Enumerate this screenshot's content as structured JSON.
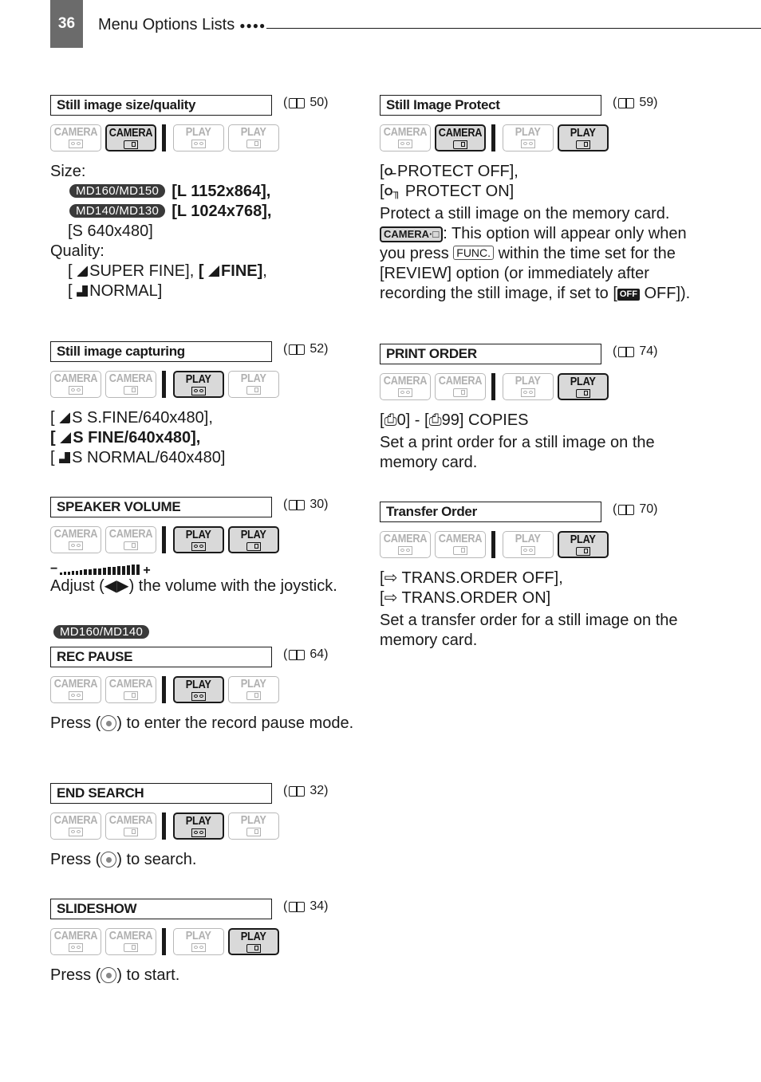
{
  "header": {
    "page_number": "36",
    "title": "Menu Options Lists",
    "dots": "●●●●"
  },
  "mode_labels": {
    "camera": "CAMERA",
    "play": "PLAY"
  },
  "sections": {
    "size_quality": {
      "title": "Still image size/quality",
      "ref_page": "50",
      "modes": {
        "camera_tape": false,
        "camera_card": true,
        "play_tape": false,
        "play_card": false
      },
      "size_label": "Size:",
      "sizes": [
        {
          "badge": "MD160/MD150",
          "value": "[L 1152x864],",
          "bold": true
        },
        {
          "badge": "MD140/MD130",
          "value": "[L 1024x768],",
          "bold": true
        },
        {
          "badge": "",
          "value": "[S 640x480]",
          "bold": false
        }
      ],
      "quality_label": "Quality:",
      "quality": {
        "super_fine": "SUPER FINE], ",
        "fine": "FINE]",
        "normal": "NORMAL]"
      }
    },
    "capturing": {
      "title": "Still image capturing",
      "ref_page": "52",
      "modes": {
        "camera_tape": false,
        "camera_card": false,
        "play_tape": true,
        "play_card": false
      },
      "options": [
        "S S.FINE/640x480],",
        "S FINE/640x480],",
        "S NORMAL/640x480]"
      ]
    },
    "speaker": {
      "title": "SPEAKER VOLUME",
      "ref_page": "30",
      "modes": {
        "camera_tape": false,
        "camera_card": false,
        "play_tape": true,
        "play_card": true
      },
      "volume_min": "−",
      "volume_max": "+",
      "text": "Adjust (◀▶) the volume with the joystick."
    },
    "model_badge": "MD160/MD140",
    "rec_pause": {
      "title": "REC PAUSE",
      "ref_page": "64",
      "modes": {
        "camera_tape": false,
        "camera_card": false,
        "play_tape": true,
        "play_card": false
      },
      "text_before": "Press (",
      "text_after": ") to enter the record pause mode."
    },
    "end_search": {
      "title": "END SEARCH",
      "ref_page": "32",
      "modes": {
        "camera_tape": false,
        "camera_card": false,
        "play_tape": true,
        "play_card": false
      },
      "text_before": "Press (",
      "text_after": ") to search."
    },
    "slideshow": {
      "title": "SLIDESHOW",
      "ref_page": "34",
      "modes": {
        "camera_tape": false,
        "camera_card": false,
        "play_tape": false,
        "play_card": true
      },
      "text_before": "Press (",
      "text_after": ") to start."
    },
    "protect": {
      "title": "Still Image Protect",
      "ref_page": "59",
      "modes": {
        "camera_tape": false,
        "camera_card": true,
        "play_tape": false,
        "play_card": true
      },
      "opt_off": " PROTECT OFF],",
      "opt_on": " PROTECT ON]",
      "desc": "Protect a still image on the memory card.",
      "cam_badge": "CAMERA·□",
      "note_1": ": This option will appear only when you press ",
      "func_key": "FUNC.",
      "note_2": " within the time set for the [REVIEW] option (or immediately after recording the still image, if set to [",
      "off_badge": "OFF",
      "note_3": " OFF])."
    },
    "print_order": {
      "title": "PRINT ORDER",
      "ref_page": "74",
      "modes": {
        "camera_tape": false,
        "camera_card": false,
        "play_tape": false,
        "play_card": true
      },
      "range": "0] - [",
      "range_end": "99] COPIES",
      "desc": "Set a print order for a still image on the memory card."
    },
    "transfer_order": {
      "title": "Transfer Order",
      "ref_page": "70",
      "modes": {
        "camera_tape": false,
        "camera_card": false,
        "play_tape": false,
        "play_card": true
      },
      "opt_off": " TRANS.ORDER OFF],",
      "opt_on": " TRANS.ORDER ON]",
      "desc": "Set a transfer order for a still image on the memory card."
    }
  }
}
